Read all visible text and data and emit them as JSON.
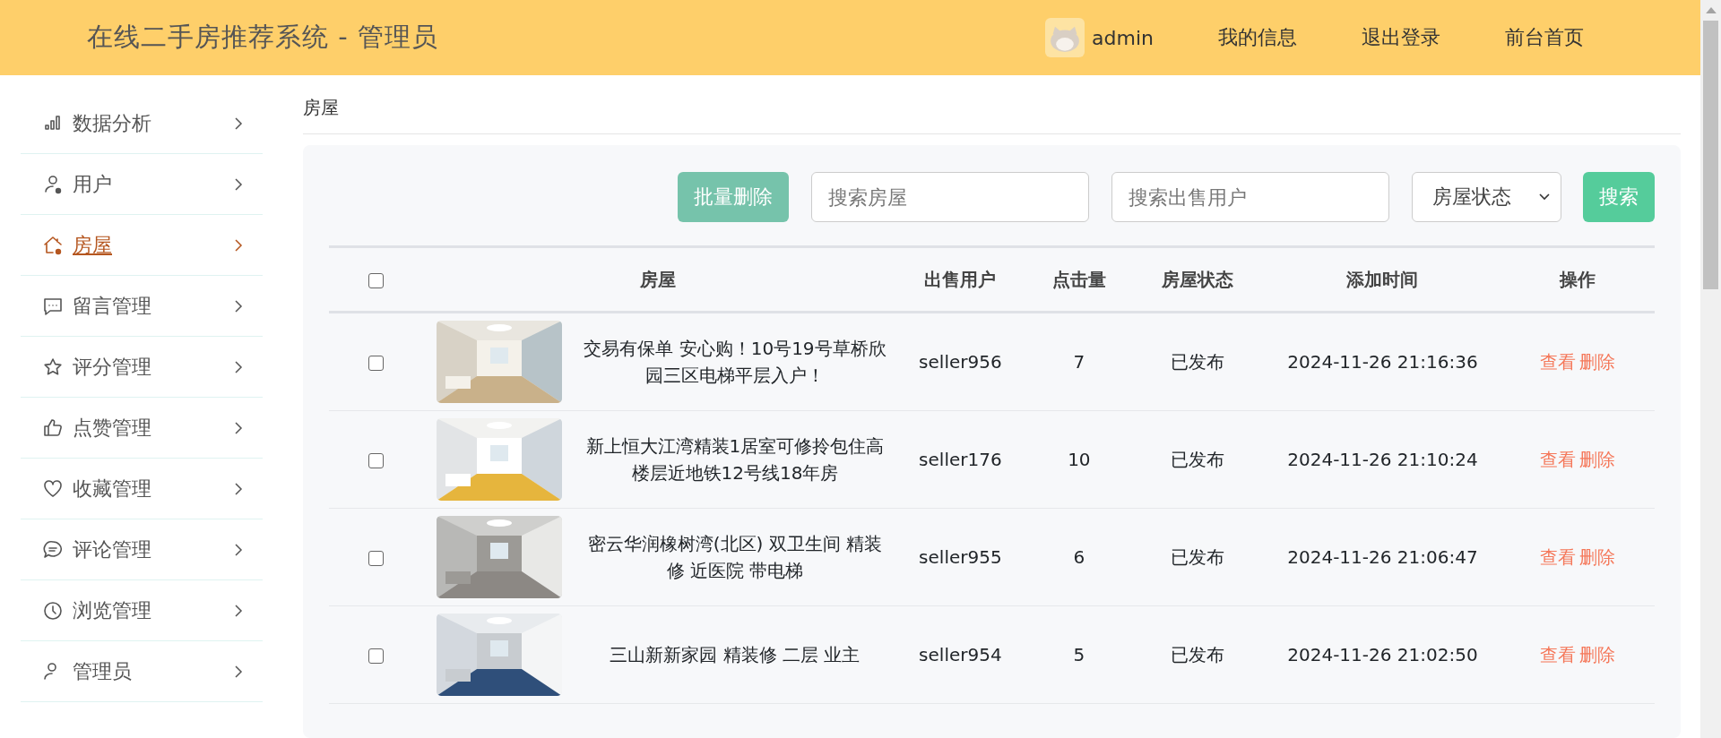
{
  "header": {
    "title": "在线二手房推荐系统 - 管理员",
    "user": "admin",
    "links": [
      "我的信息",
      "退出登录",
      "前台首页"
    ]
  },
  "sidebar": {
    "items": [
      {
        "label": "数据分析",
        "selected": false
      },
      {
        "label": "用户",
        "selected": false
      },
      {
        "label": "房屋",
        "selected": true
      },
      {
        "label": "留言管理",
        "selected": false
      },
      {
        "label": "评分管理",
        "selected": false
      },
      {
        "label": "点赞管理",
        "selected": false
      },
      {
        "label": "收藏管理",
        "selected": false
      },
      {
        "label": "评论管理",
        "selected": false
      },
      {
        "label": "浏览管理",
        "selected": false
      },
      {
        "label": "管理员",
        "selected": false
      }
    ]
  },
  "breadcrumb": "房屋",
  "toolbar": {
    "batch_delete": "批量删除",
    "house_search": {
      "placeholder": "搜索房屋"
    },
    "seller_search": {
      "placeholder": "搜索出售用户"
    },
    "status_select": "房屋状态",
    "search": "搜索"
  },
  "table": {
    "select_all": {
      "checked": false
    },
    "columns": [
      "房屋",
      "出售用户",
      "点击量",
      "房屋状态",
      "添加时间",
      "操作"
    ],
    "rows": [
      {
        "checked": false,
        "title": "交易有保单 安心购！10号19号草桥欣园三区电梯平层入户！",
        "seller": "seller956",
        "clicks": "7",
        "status": "已发布",
        "added": "2024-11-26 21:16:36",
        "actions": [
          "查看",
          "删除"
        ]
      },
      {
        "checked": false,
        "title": "新上恒大江湾精装1居室可修拎包住高楼层近地铁12号线18年房",
        "seller": "seller176",
        "clicks": "10",
        "status": "已发布",
        "added": "2024-11-26 21:10:24",
        "actions": [
          "查看",
          "删除"
        ]
      },
      {
        "checked": false,
        "title": "密云华润橡树湾(北区) 双卫生间 精装修 近医院 带电梯",
        "seller": "seller955",
        "clicks": "6",
        "status": "已发布",
        "added": "2024-11-26 21:06:47",
        "actions": [
          "查看",
          "删除"
        ]
      },
      {
        "checked": false,
        "title": "三山新新家园 精装修 二层 业主",
        "seller": "seller954",
        "clicks": "5",
        "status": "已发布",
        "added": "2024-11-26 21:02:50",
        "actions": [
          "查看",
          "删除"
        ]
      }
    ]
  }
}
